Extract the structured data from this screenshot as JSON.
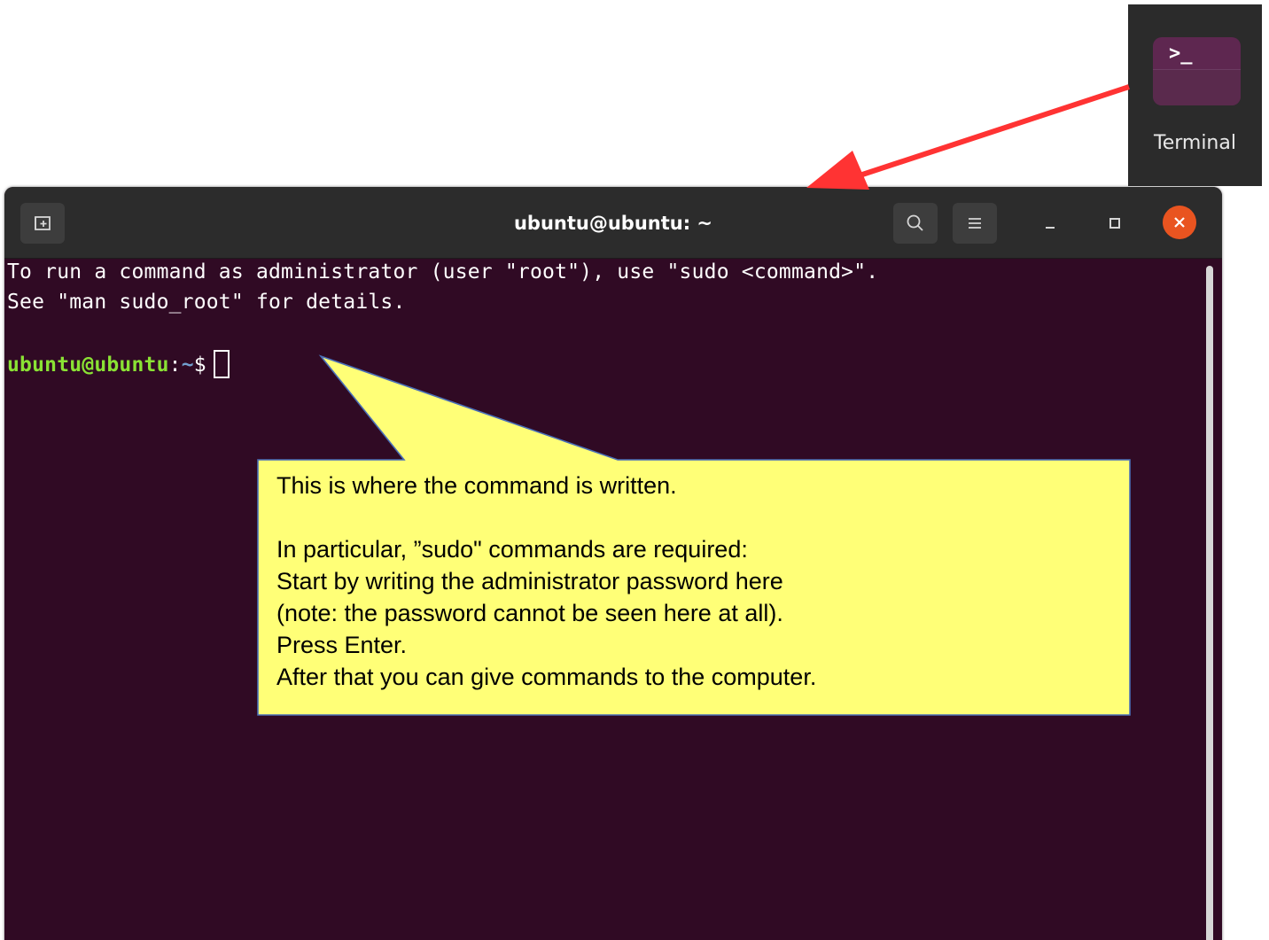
{
  "launcher": {
    "icon": "terminal-icon",
    "glyph": ">_",
    "label": "Terminal"
  },
  "window": {
    "title": "ubuntu@ubuntu: ~",
    "buttons": {
      "new_tab": "new-tab-icon",
      "search": "search-icon",
      "menu": "hamburger-menu-icon",
      "minimize": "minimize-icon",
      "maximize": "maximize-icon",
      "close": "close-icon"
    }
  },
  "terminal": {
    "lines": [
      "To run a command as administrator (user \"root\"), use \"sudo <command>\".",
      "See \"man sudo_root\" for details."
    ],
    "prompt": {
      "user_host": "ubuntu@ubuntu",
      "separator": ":",
      "path": "~",
      "symbol": "$"
    }
  },
  "callout": {
    "lines": [
      "This is where the command is written.",
      "",
      "In particular, ”sudo\" commands are required:",
      "Start by writing the administrator password here",
      "(note: the password cannot be seen here at all).",
      "Press Enter.",
      "After that you can give commands to the computer."
    ]
  },
  "colors": {
    "terminal_bg": "#300a24",
    "titlebar_bg": "#2c2c2c",
    "close_button": "#e95420",
    "prompt_user": "#8ae234",
    "prompt_path": "#729fcf",
    "callout_fill": "#ffff77",
    "callout_border": "#4a6fb8",
    "arrow": "#ff3333"
  }
}
